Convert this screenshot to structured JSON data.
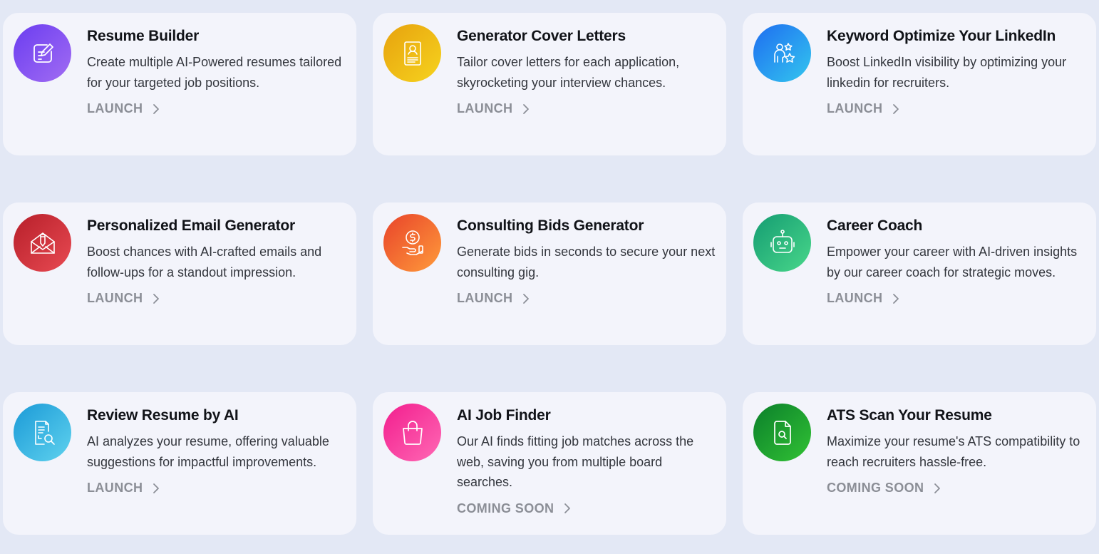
{
  "chevron_icon": "chevron-right-icon",
  "cards": [
    {
      "title": "Resume Builder",
      "description": "Create multiple AI-Powered resumes tailored for your targeted job positions.",
      "action": "LAUNCH",
      "icon": "edit-document-icon",
      "gradient": [
        "#6b3df0",
        "#a16cf3"
      ]
    },
    {
      "title": "Generator Cover Letters",
      "description": "Tailor cover letters for each application, skyrocketing your interview chances.",
      "action": "LAUNCH",
      "icon": "profile-document-icon",
      "gradient": [
        "#e7a20e",
        "#f6d31e"
      ]
    },
    {
      "title": "Keyword Optimize Your LinkedIn",
      "description": "Boost LinkedIn visibility by optimizing your linkedin for recruiters.",
      "action": "LAUNCH",
      "icon": "person-stars-icon",
      "gradient": [
        "#1e6df0",
        "#33c6ef"
      ]
    },
    {
      "title": "Personalized Email Generator",
      "description": "Boost chances with AI-crafted emails and follow-ups for a standout impression.",
      "action": "LAUNCH",
      "icon": "envelope-pencil-icon",
      "gradient": [
        "#b71f2a",
        "#e84a52"
      ]
    },
    {
      "title": "Consulting Bids Generator",
      "description": "Generate bids in seconds to secure your next consulting gig.",
      "action": "LAUNCH",
      "icon": "coin-hand-icon",
      "gradient": [
        "#e8432a",
        "#ff9b3b"
      ]
    },
    {
      "title": "Career Coach",
      "description": "Empower your career with AI-driven insights by our career coach for strategic moves.",
      "action": "LAUNCH",
      "icon": "robot-icon",
      "gradient": [
        "#149c72",
        "#49d78a"
      ]
    },
    {
      "title": "Review Resume by AI",
      "description": "AI analyzes your resume, offering valuable suggestions for impactful improvements.",
      "action": "LAUNCH",
      "icon": "document-search-icon",
      "gradient": [
        "#1b9ad7",
        "#5fd2ee"
      ]
    },
    {
      "title": "AI Job Finder",
      "description": "Our AI finds fitting job matches across the web, saving you from multiple board searches.",
      "action": "COMING SOON",
      "icon": "shopping-bag-icon",
      "gradient": [
        "#f21e8e",
        "#ff68b4"
      ]
    },
    {
      "title": "ATS Scan Your Resume",
      "description": "Maximize your resume's ATS compatibility to reach recruiters hassle-free.",
      "action": "COMING SOON",
      "icon": "file-scan-icon",
      "gradient": [
        "#0b7f2b",
        "#31c234"
      ]
    }
  ]
}
